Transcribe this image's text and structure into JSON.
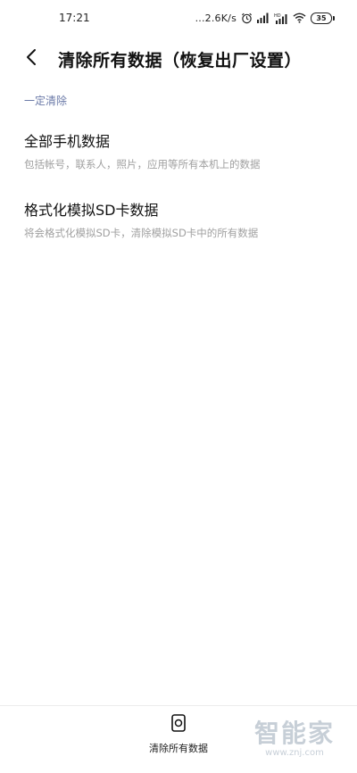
{
  "status_bar": {
    "time": "17:21",
    "net_speed": "...2.6K/s",
    "battery": "35",
    "icons": [
      "alarm-icon",
      "signal-icon",
      "hd-signal-icon",
      "wifi-icon",
      "battery-icon"
    ]
  },
  "header": {
    "back_icon": "chevron-left-icon",
    "title": "清除所有数据（恢复出厂设置）"
  },
  "section": {
    "label": "一定清除"
  },
  "items": [
    {
      "title": "全部手机数据",
      "desc": "包括帐号，联系人，照片，应用等所有本机上的数据"
    },
    {
      "title": "格式化模拟SD卡数据",
      "desc": "将会格式化模拟SD卡，清除模拟SD卡中的所有数据"
    }
  ],
  "bottom": {
    "action_label": "清除所有数据",
    "action_icon": "phone-clear-icon"
  },
  "watermark": {
    "text": "智能家",
    "url": "www.znj.com"
  },
  "colors": {
    "accent_section": "#6b7aa8",
    "secondary_text": "#a0a0a0"
  }
}
